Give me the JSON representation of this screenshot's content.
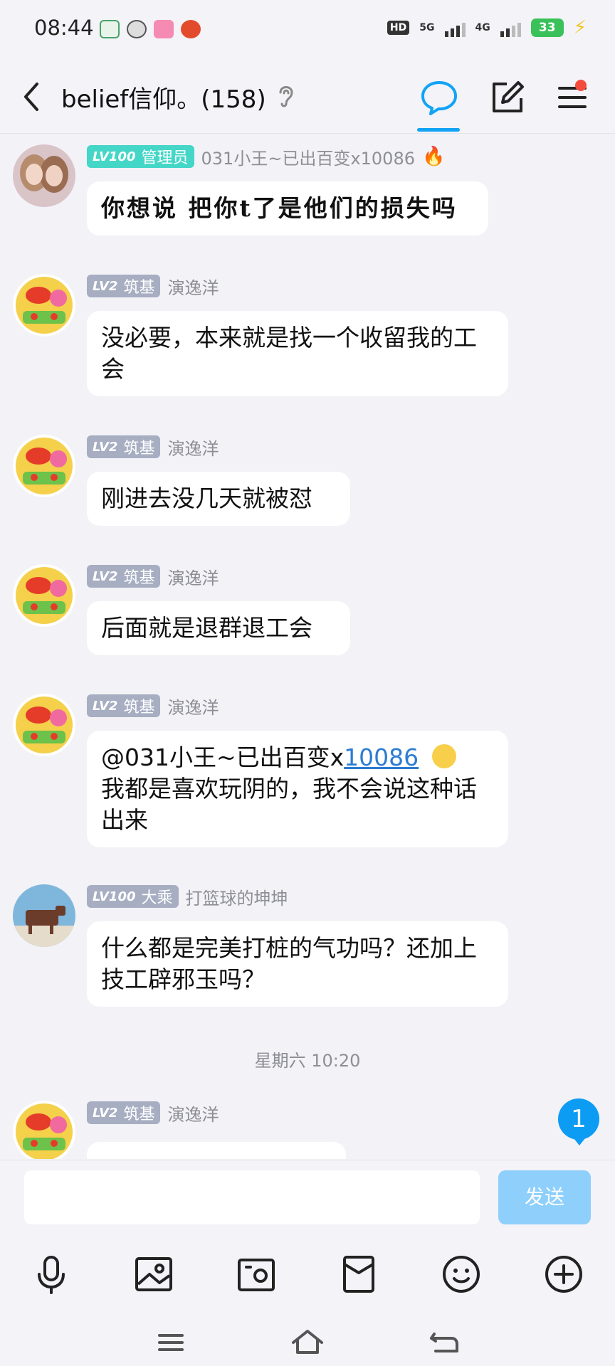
{
  "status_bar": {
    "time": "08:44",
    "network_hd": "HD",
    "network_5g": "5G",
    "network_4g": "4G",
    "battery": "33"
  },
  "header": {
    "title": "belief信仰。(158)"
  },
  "messages": [
    {
      "level": "LV100",
      "rank": "管理员",
      "nickname": "031小王~已出百变x10086",
      "text": "你想说  把你t了是他们的损失吗"
    },
    {
      "level": "LV2",
      "rank": "筑基",
      "nickname": "演逸洋",
      "text": "没必要，本来就是找一个收留我的工会"
    },
    {
      "level": "LV2",
      "rank": "筑基",
      "nickname": "演逸洋",
      "text": "刚进去没几天就被怼"
    },
    {
      "level": "LV2",
      "rank": "筑基",
      "nickname": "演逸洋",
      "text": "后面就是退群退工会"
    },
    {
      "level": "LV2",
      "rank": "筑基",
      "nickname": "演逸洋",
      "mention": "@031小王~已出百变x",
      "mention_link": "10086",
      "text": "我都是喜欢玩阴的，我不会说这种话出来"
    },
    {
      "level": "LV100",
      "rank": "大乘",
      "nickname": "打篮球的坤坤",
      "text": "什么都是完美打桩的气功吗？还加上技工辟邪玉吗？"
    },
    {
      "level": "LV2",
      "rank": "筑基",
      "nickname": "演逸洋",
      "text": ""
    }
  ],
  "timestamp": "星期六 10:20",
  "unread_count": "1",
  "input": {
    "placeholder": "",
    "send_label": "发送"
  },
  "colors": {
    "accent": "#12a3f5",
    "admin_badge": "#44d6c6",
    "rank_badge": "#a7aec2",
    "send_disabled": "#8fcffb",
    "notification_dot": "#f34b3c"
  }
}
